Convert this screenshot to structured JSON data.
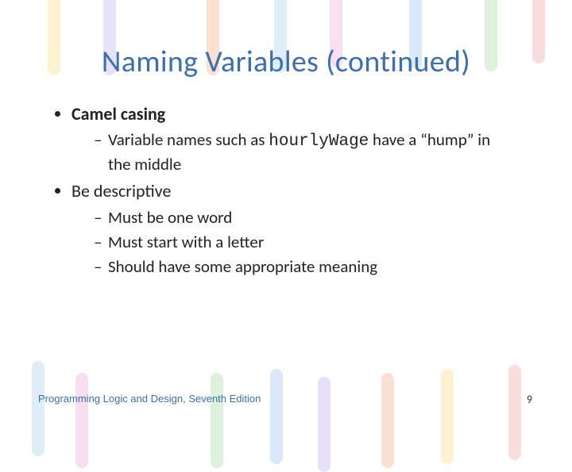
{
  "title": "Naming Variables (continued)",
  "bullets": [
    {
      "label": "Camel casing",
      "bold": true,
      "sub": [
        {
          "pre": "Variable names such as ",
          "code": "hourlyWage",
          "post": " have a “hump” in the middle"
        }
      ]
    },
    {
      "label": "Be descriptive",
      "bold": false,
      "sub": [
        {
          "pre": "Must be one word",
          "code": "",
          "post": ""
        },
        {
          "pre": "Must start with a letter",
          "code": "",
          "post": ""
        },
        {
          "pre": "Should have some appropriate meaning",
          "code": "",
          "post": ""
        }
      ]
    }
  ],
  "footer": "Programming Logic and Design, Seventh Edition",
  "page": "9"
}
